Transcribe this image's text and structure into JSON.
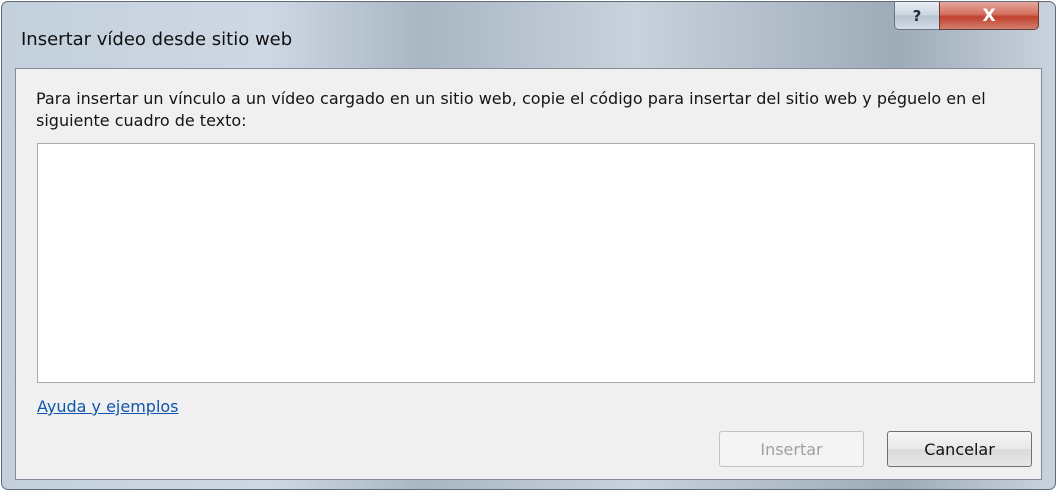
{
  "window": {
    "title": "Insertar vídeo desde sitio web",
    "help_label": "?",
    "close_label": "X"
  },
  "dialog": {
    "instructions": "Para insertar un vínculo a un vídeo cargado en un sitio web, copie el código para insertar del sitio web y péguelo en el siguiente cuadro de texto:",
    "textarea_value": "",
    "help_link": "Ayuda y ejemplos",
    "insert_label": "Insertar",
    "insert_enabled": false,
    "cancel_label": "Cancelar"
  },
  "icons": {
    "help": "question-mark-icon",
    "close": "close-x-icon"
  },
  "colors": {
    "link": "#0f55b0",
    "close_button": "#c0412d",
    "disabled_text": "#a0a0a0"
  }
}
